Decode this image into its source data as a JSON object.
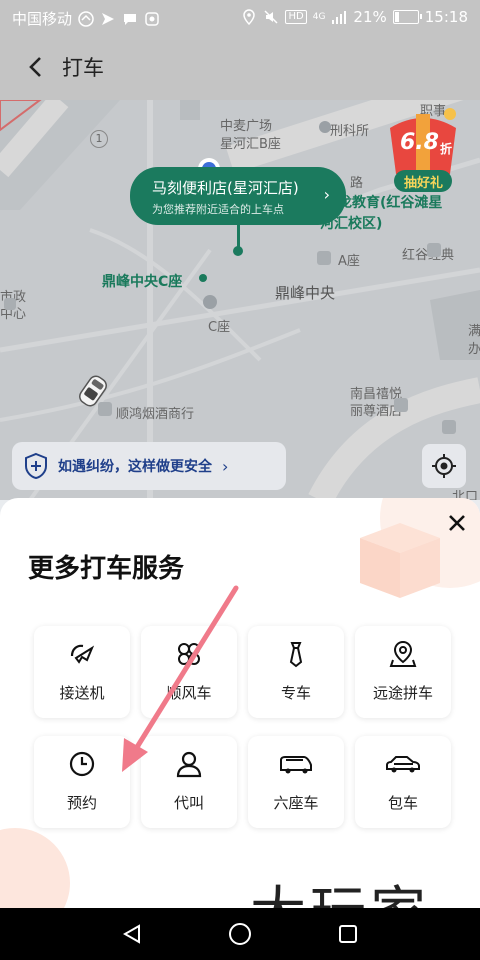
{
  "status": {
    "carrier": "中国移动",
    "hd": "HD",
    "network": "4G",
    "battery": "21%",
    "battery_level": 0.21,
    "time": "15:18"
  },
  "header": {
    "title": "打车"
  },
  "map": {
    "labels": {
      "road_circle": "1",
      "zhongmai": "中麦广场",
      "xinghe": "星河汇B座",
      "xingfu": "刑科所",
      "road": "路",
      "edu": "龙教育(红谷滩星",
      "edu2": "河汇校区)",
      "hongguyy": "红谷经典",
      "aseat": "A座",
      "dingfeng_c": "鼎峰中央C座",
      "dingfeng": "鼎峰中央",
      "shizheng": "市政",
      "shizheng2": "中心",
      "cseat": "C座",
      "shunhong": "顺鸿烟酒商行",
      "nanchang": "南昌禧悦",
      "nanchang2": "丽尊酒店",
      "beikou": "北口",
      "right1": "满",
      "right2": "办",
      "top_right": "职事"
    },
    "pickup": {
      "name": "马刻便利店(星河汇店)",
      "hint": "为您推荐附近适合的上车点"
    },
    "promo": {
      "discount": "6.8",
      "unit": "折",
      "action": "抽好礼"
    },
    "safety_text": "如遇纠纷，这样做更安全"
  },
  "sheet": {
    "title": "更多打车服务",
    "services": [
      {
        "label": "接送机",
        "icon": "airplane-icon"
      },
      {
        "label": "顺风车",
        "icon": "flower-icon"
      },
      {
        "label": "专车",
        "icon": "tie-icon"
      },
      {
        "label": "远途拼车",
        "icon": "map-pin-icon"
      },
      {
        "label": "预约",
        "icon": "clock-icon"
      },
      {
        "label": "代叫",
        "icon": "person-icon"
      },
      {
        "label": "六座车",
        "icon": "van-icon"
      },
      {
        "label": "包车",
        "icon": "car-icon"
      }
    ]
  },
  "annotation_color": "#f07a8a",
  "watermark": "大玩家"
}
